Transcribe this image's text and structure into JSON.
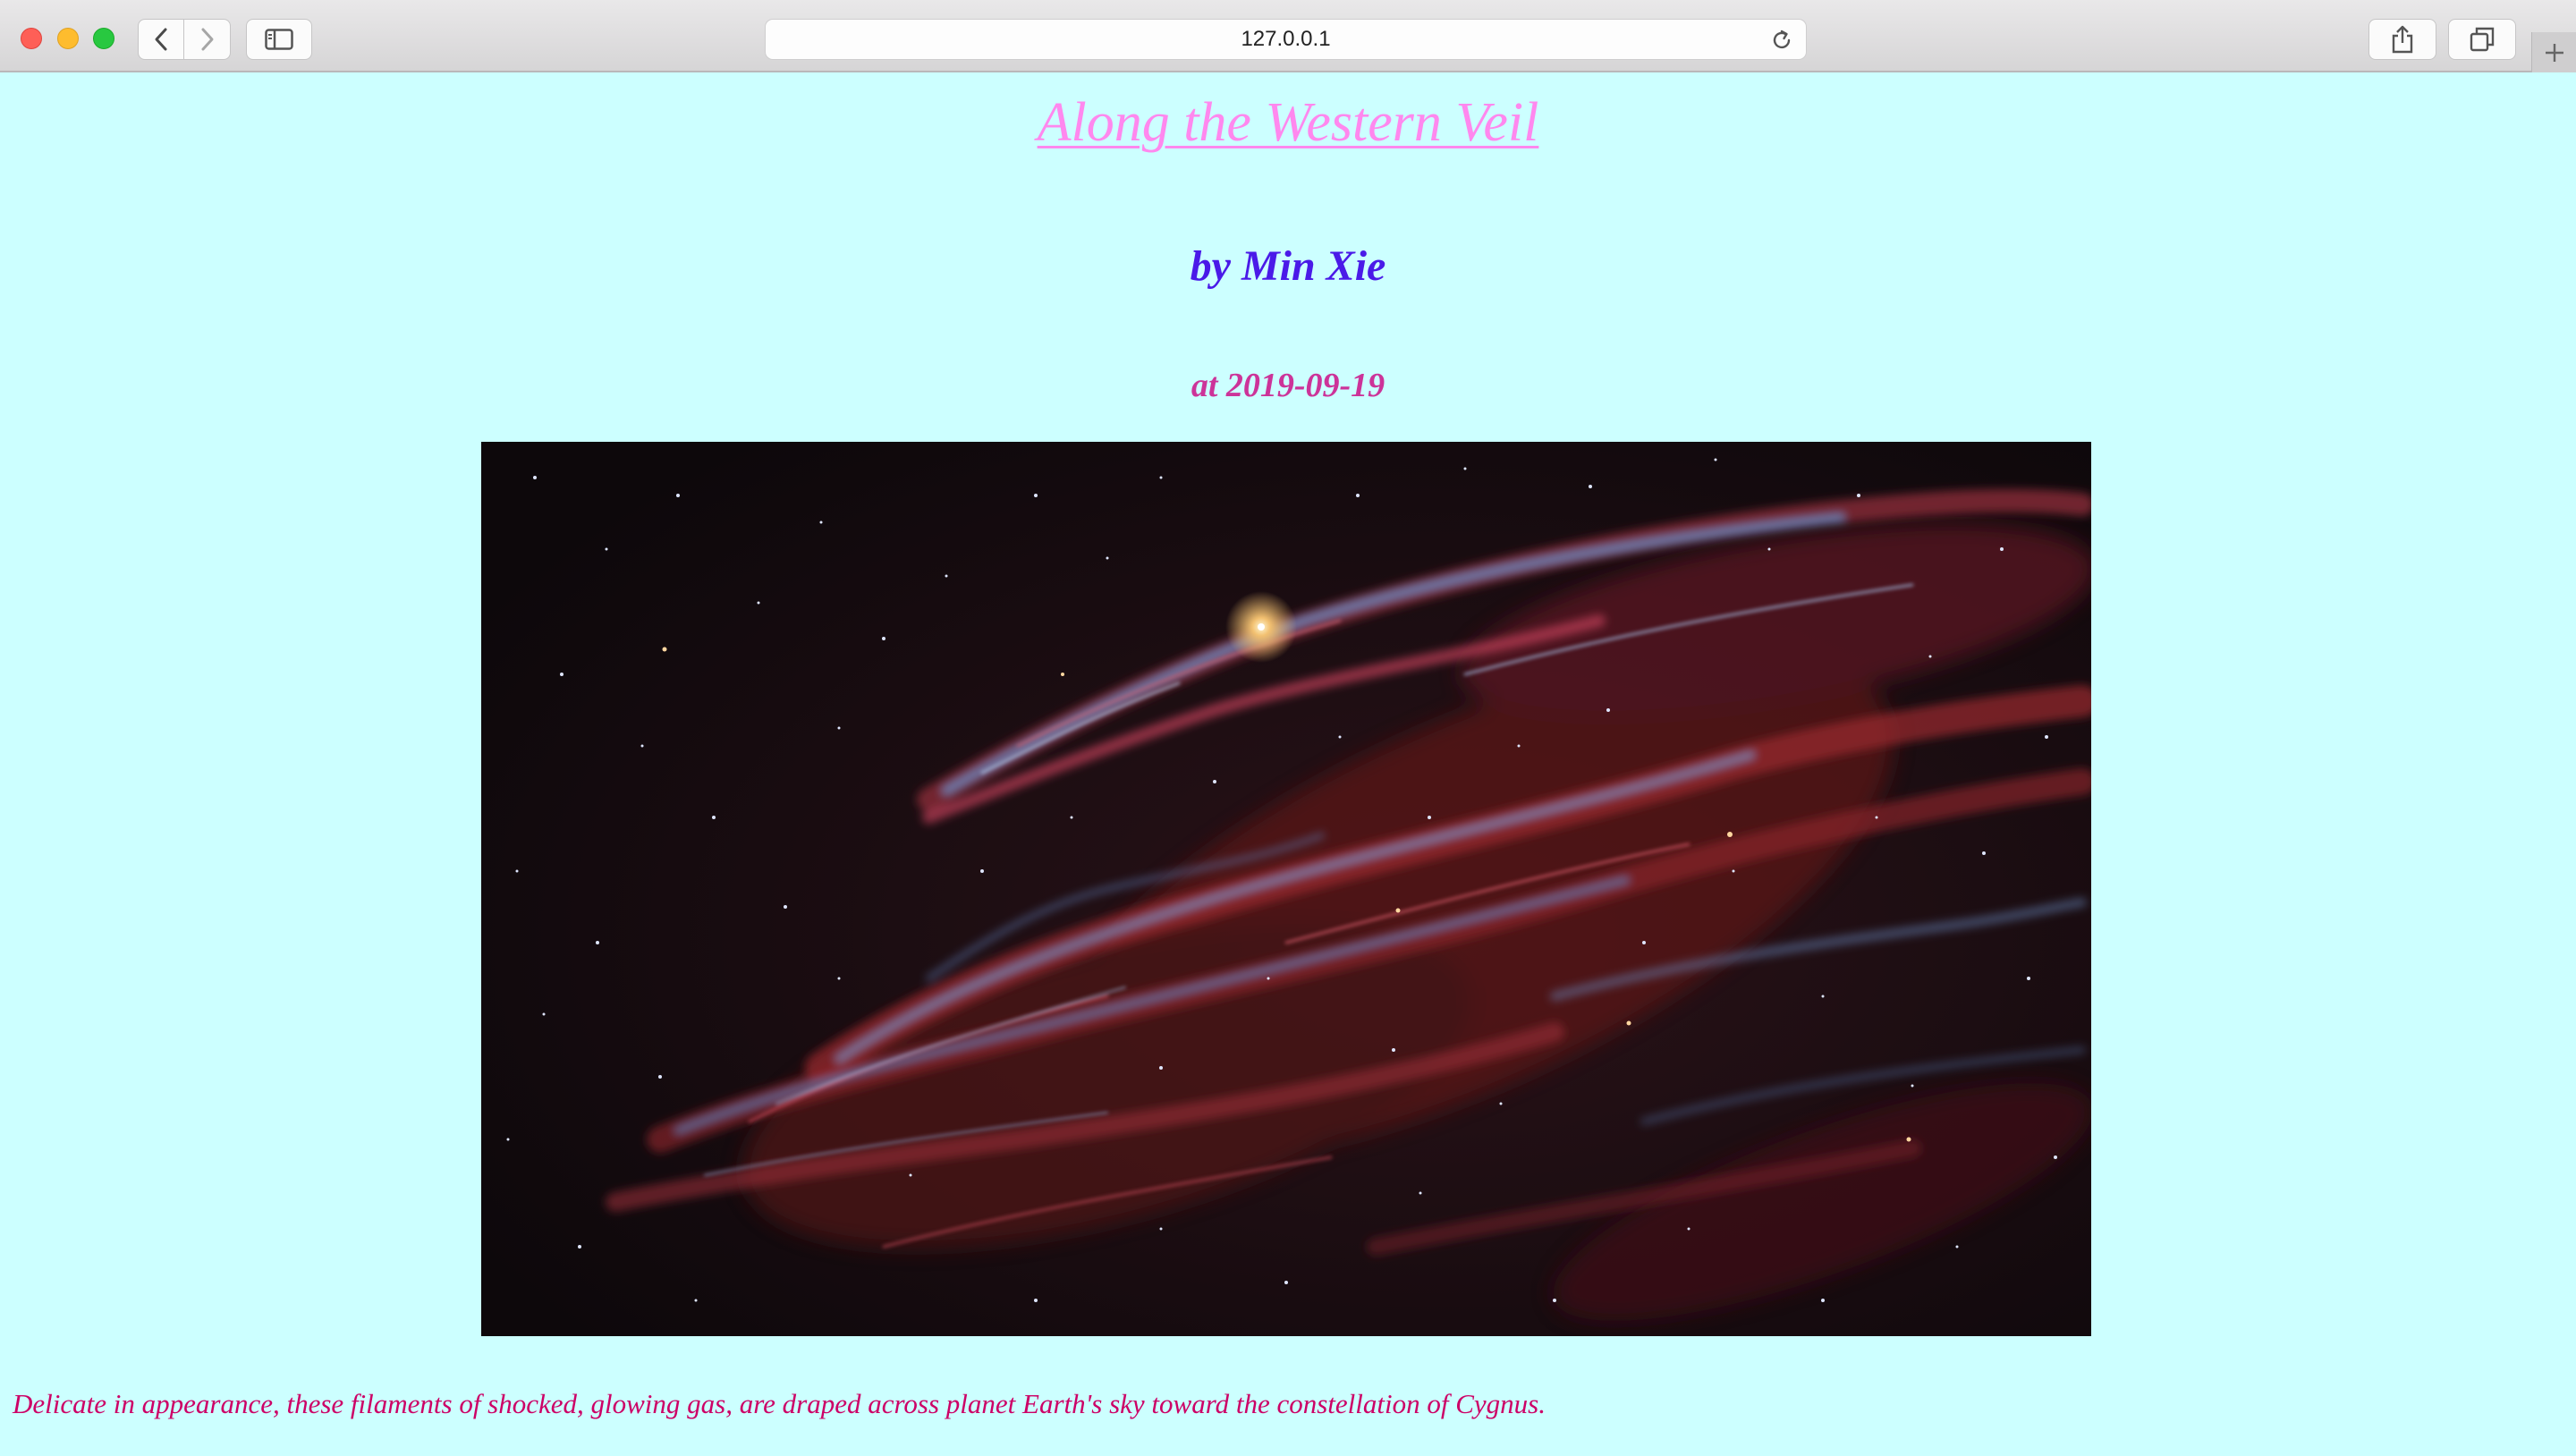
{
  "browser": {
    "url": "127.0.0.1",
    "icons": {
      "back": "chevron-left-icon",
      "forward": "chevron-right-icon",
      "sidebar": "sidebar-icon",
      "reload": "reload-icon",
      "share": "share-icon",
      "tabs": "tabs-overview-icon",
      "new_tab": "plus-icon"
    }
  },
  "post": {
    "title": "Along the Western Veil ",
    "author": "by Min Xie",
    "date": "at 2019-09-19",
    "caption": "Delicate in appearance, these filaments of shocked, glowing gas, are draped across planet Earth's sky toward the constellation of Cygnus."
  },
  "colors": {
    "page_background": "#ccffff",
    "title": "#ff88ee",
    "author": "#4a1ae8",
    "date": "#cc3399",
    "caption": "#cc0066"
  }
}
